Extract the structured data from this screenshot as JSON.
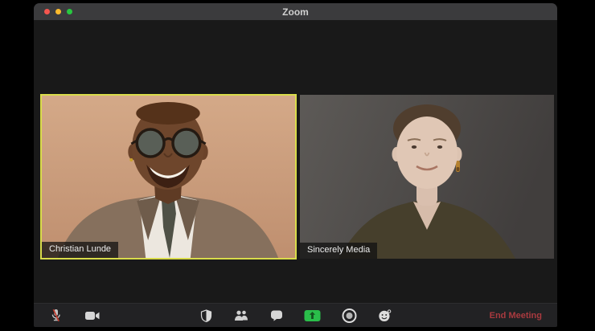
{
  "window": {
    "title": "Zoom",
    "traffic_lights": [
      {
        "name": "close",
        "color": "#f6564f"
      },
      {
        "name": "minimize",
        "color": "#fdbb2d"
      },
      {
        "name": "zoom",
        "color": "#28c840"
      }
    ]
  },
  "meeting": {
    "participants": [
      {
        "name": "Christian Lunde",
        "active_speaker": true
      },
      {
        "name": "Sincerely Media",
        "active_speaker": false
      }
    ]
  },
  "toolbar": {
    "icons": [
      "microphone-muted-icon",
      "video-camera-icon",
      "security-shield-icon",
      "participants-icon",
      "chat-bubble-icon",
      "share-screen-icon",
      "record-icon",
      "reactions-smiley-icon"
    ],
    "end_meeting_label": "End Meeting"
  },
  "colors": {
    "active_speaker_border": "#d9dc4a",
    "share_screen_green": "#2abe4a",
    "end_meeting_red": "#a93a3f",
    "titlebar": "#3b3b3d",
    "toolbar": "#222224",
    "content_background": "#191919"
  }
}
